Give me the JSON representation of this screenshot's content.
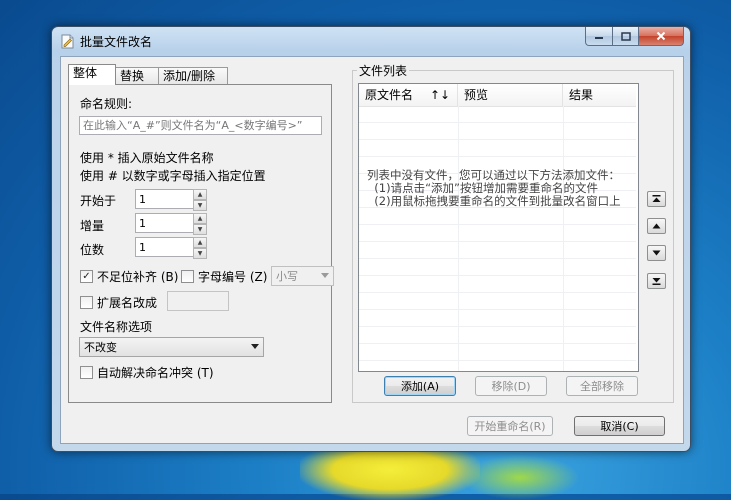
{
  "window": {
    "title": "批量文件改名",
    "app_icon": "document-edit-icon"
  },
  "tabs": [
    {
      "label": "整体",
      "active": true
    },
    {
      "label": "替换",
      "active": false
    },
    {
      "label": "添加/删除",
      "active": false
    }
  ],
  "rule": {
    "label": "命名规则:",
    "placeholder": "在此输入“A_#”则文件名为“A_<数字编号>”",
    "help_line1": "使用 * 插入原始文件名称",
    "help_line2": "使用 # 以数字或字母插入指定位置"
  },
  "start": {
    "label": "开始于",
    "value": "1"
  },
  "step": {
    "label": "增量",
    "value": "1"
  },
  "digits": {
    "label": "位数",
    "value": "1"
  },
  "pad_zero": {
    "label": "不足位补齐 (B)",
    "checked": true
  },
  "letter_number": {
    "label": "字母编号 (Z)",
    "checked": false,
    "case_value": "小写"
  },
  "ext_change": {
    "label": "扩展名改成",
    "checked": false,
    "value": ""
  },
  "name_option": {
    "label": "文件名称选项",
    "value": "不改变"
  },
  "auto_resolve": {
    "label": "自动解决命名冲突 (T)",
    "checked": false
  },
  "file_list": {
    "title": "文件列表",
    "columns": [
      "原文件名",
      "预览",
      "结果"
    ],
    "sort_glyph": "↑↓",
    "empty_hint": [
      "列表中没有文件，您可以通过以下方法添加文件：",
      "  (1)请点击“添加”按钮增加需要重命名的文件",
      "  (2)用鼠标拖拽要重命名的文件到批量改名窗口上"
    ]
  },
  "list_buttons": {
    "add": "添加(A)",
    "remove": "移除(D)",
    "remove_all": "全部移除"
  },
  "footer": {
    "start_rename": "开始重命名(R)",
    "cancel": "取消(C)"
  },
  "side_buttons": [
    "move-top-icon",
    "move-up-icon",
    "move-down-icon",
    "move-bottom-icon"
  ]
}
